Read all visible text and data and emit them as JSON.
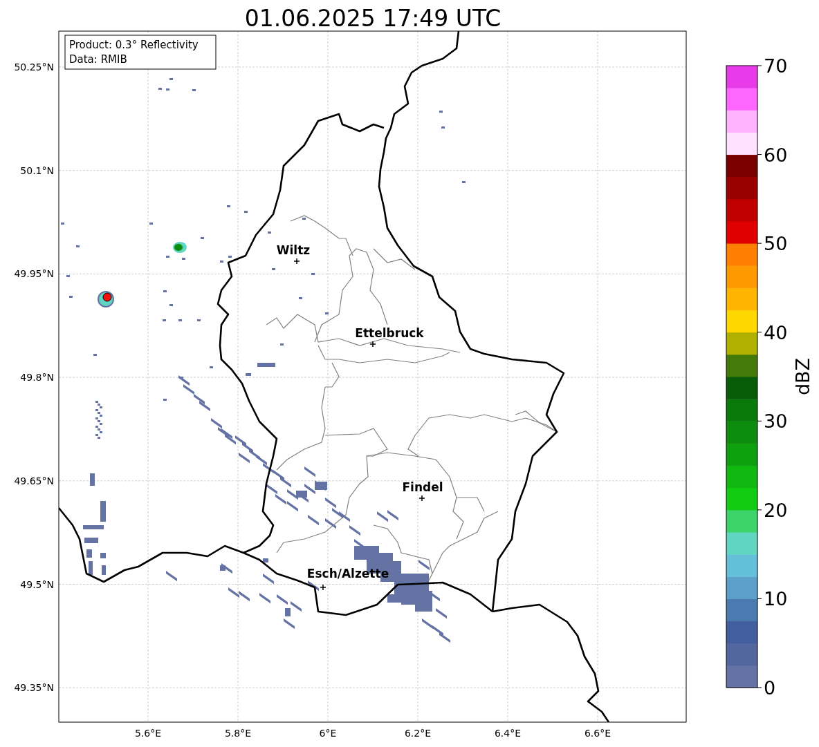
{
  "title": "01.06.2025 17:49 UTC",
  "info_box": {
    "lines": [
      "Product: 0.3° Reflectivity",
      "Data: RMIB"
    ]
  },
  "map": {
    "lat_labels": [
      "50.25°N",
      "50.1°N",
      "49.95°N",
      "49.8°N",
      "49.65°N",
      "49.5°N",
      "49.35°N"
    ],
    "lon_labels": [
      "5.6°E",
      "5.8°E",
      "6°E",
      "6.2°E",
      "6.4°E",
      "6.6°E"
    ],
    "cities": [
      {
        "name": "Wiltz"
      },
      {
        "name": "Ettelbruck"
      },
      {
        "name": "Findel"
      },
      {
        "name": "Esch/Alzette"
      }
    ]
  },
  "colorbar": {
    "label": "dBZ",
    "ticks": [
      "70",
      "60",
      "50",
      "40",
      "30",
      "20",
      "10",
      "0"
    ],
    "bands": [
      {
        "color": "#6473a3"
      },
      {
        "color": "#53679e"
      },
      {
        "color": "#435e9e"
      },
      {
        "color": "#4a7ab0"
      },
      {
        "color": "#5aa0c8"
      },
      {
        "color": "#63c0d8"
      },
      {
        "color": "#60d6c0"
      },
      {
        "color": "#3dd46b"
      },
      {
        "color": "#12cc12"
      },
      {
        "color": "#10b810"
      },
      {
        "color": "#0fa00f"
      },
      {
        "color": "#0d8c0d"
      },
      {
        "color": "#0a7a0a"
      },
      {
        "color": "#085c08"
      },
      {
        "color": "#447a0a"
      },
      {
        "color": "#b0b000"
      },
      {
        "color": "#ffd700"
      },
      {
        "color": "#ffb400"
      },
      {
        "color": "#ff9900"
      },
      {
        "color": "#ff7f00"
      },
      {
        "color": "#e00000"
      },
      {
        "color": "#c00000"
      },
      {
        "color": "#9a0000"
      },
      {
        "color": "#7a0000"
      },
      {
        "color": "#ffe0ff"
      },
      {
        "color": "#ffb3ff"
      },
      {
        "color": "#ff66ff"
      },
      {
        "color": "#e93ae9"
      }
    ]
  }
}
